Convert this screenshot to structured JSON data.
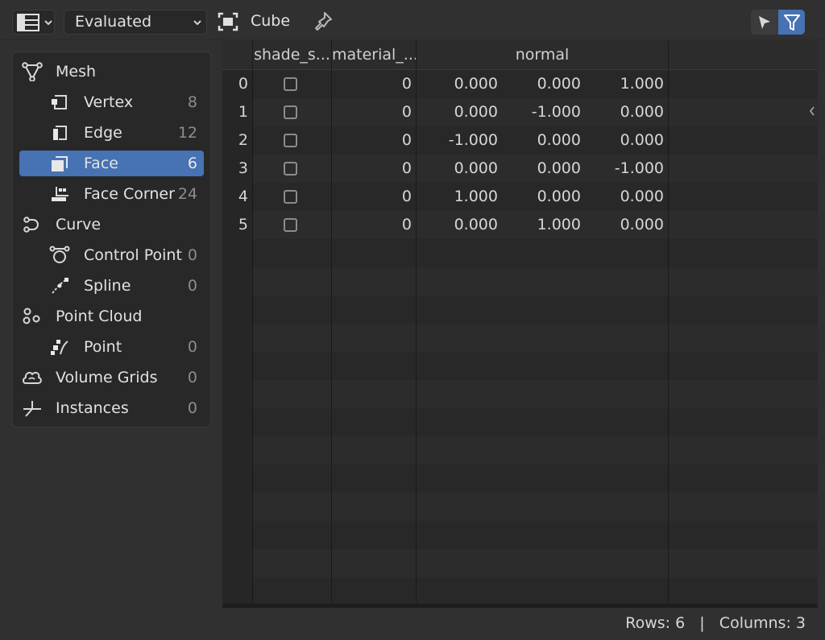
{
  "header": {
    "editor_type_icon": "spreadsheet-icon",
    "evaluation_mode": "Evaluated",
    "object_icon": "object-bounds-icon",
    "object_name": "Cube",
    "pin_icon": "pin-icon",
    "select_icon": "cursor-arrow-icon",
    "filter_icon": "funnel-icon",
    "accent_color": "#4772b3"
  },
  "sidebar": {
    "items": [
      {
        "label": "Mesh",
        "count": "",
        "icon": "mesh-icon"
      },
      {
        "label": "Vertex",
        "count": "8",
        "icon": "vertex-icon"
      },
      {
        "label": "Edge",
        "count": "12",
        "icon": "edge-icon"
      },
      {
        "label": "Face",
        "count": "6",
        "icon": "face-icon",
        "active": true
      },
      {
        "label": "Face Corner",
        "count": "24",
        "icon": "face-corner-icon"
      },
      {
        "label": "Curve",
        "count": "",
        "icon": "curve-icon"
      },
      {
        "label": "Control Point",
        "count": "0",
        "icon": "control-point-icon"
      },
      {
        "label": "Spline",
        "count": "0",
        "icon": "spline-icon"
      },
      {
        "label": "Point Cloud",
        "count": "",
        "icon": "point-cloud-icon"
      },
      {
        "label": "Point",
        "count": "0",
        "icon": "point-icon"
      },
      {
        "label": "Volume Grids",
        "count": "0",
        "icon": "volume-icon"
      },
      {
        "label": "Instances",
        "count": "0",
        "icon": "instances-icon"
      }
    ]
  },
  "table": {
    "columns": [
      "shade_s...",
      "material_...",
      "normal"
    ],
    "rows": [
      {
        "index": "0",
        "shade_smooth": false,
        "material_index": "0",
        "normal": [
          "0.000",
          "0.000",
          "1.000"
        ]
      },
      {
        "index": "1",
        "shade_smooth": false,
        "material_index": "0",
        "normal": [
          "0.000",
          "-1.000",
          "0.000"
        ]
      },
      {
        "index": "2",
        "shade_smooth": false,
        "material_index": "0",
        "normal": [
          "-1.000",
          "0.000",
          "0.000"
        ]
      },
      {
        "index": "3",
        "shade_smooth": false,
        "material_index": "0",
        "normal": [
          "0.000",
          "0.000",
          "-1.000"
        ]
      },
      {
        "index": "4",
        "shade_smooth": false,
        "material_index": "0",
        "normal": [
          "1.000",
          "0.000",
          "0.000"
        ]
      },
      {
        "index": "5",
        "shade_smooth": false,
        "material_index": "0",
        "normal": [
          "0.000",
          "1.000",
          "0.000"
        ]
      }
    ]
  },
  "status": {
    "text": "Rows: 6   |   Columns: 3"
  }
}
